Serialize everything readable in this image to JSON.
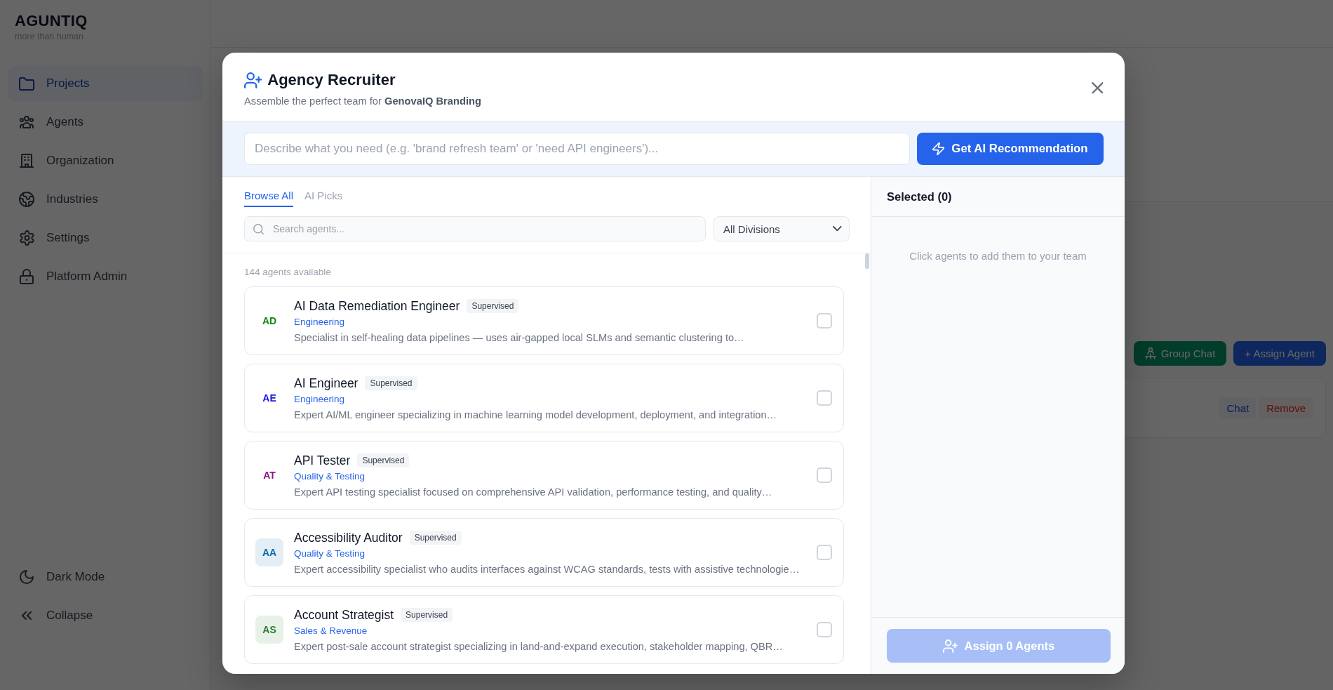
{
  "sidebar": {
    "logo": "AGUNTIQ",
    "tagline": "more than human",
    "nav_items": [
      {
        "label": "Projects",
        "selected": true
      },
      {
        "label": "Agents",
        "selected": false
      },
      {
        "label": "Organization",
        "selected": false
      },
      {
        "label": "Industries",
        "selected": false
      },
      {
        "label": "Settings",
        "selected": false
      },
      {
        "label": "Platform Admin",
        "selected": false
      }
    ],
    "footer_items": [
      {
        "label": "Dark Mode"
      },
      {
        "label": "Collapse"
      }
    ]
  },
  "background_page": {
    "toolbar_buttons": [
      {
        "label": "Group Chat",
        "kind": "success"
      },
      {
        "label": "+ Assign Agent",
        "kind": "primary"
      }
    ],
    "member_row": {
      "actions": [
        {
          "label": "Chat",
          "kind": "neutral"
        },
        {
          "label": "Remove",
          "kind": "danger"
        }
      ]
    }
  },
  "dialog": {
    "title": "Agency Recruiter",
    "subtitle": "Assemble the perfect team for **GenovaIQ Branding**",
    "request": {
      "placeholder": "Describe what you need (e.g. 'brand refresh team' or 'need API engineers')...",
      "button": "Get AI Recommendation"
    },
    "tabs": [
      {
        "label": "Browse All",
        "selected": true
      },
      {
        "label": "AI Picks",
        "selected": false
      }
    ],
    "search": {
      "placeholder": "Search agents..."
    },
    "division_filter": {
      "value": "All Divisions"
    },
    "count": "144 agents available",
    "agents": [
      {
        "initials": "AD",
        "color": "#118811",
        "tinted": false,
        "name": "AI Data Remediation Engineer",
        "badge": "Supervised",
        "division": "Engineering",
        "description": "Specialist in self-healing data pipelines — uses air-gapped local SLMs and semantic clustering to…",
        "checked": false
      },
      {
        "initials": "AE",
        "color": "#1515e0",
        "tinted": false,
        "name": "AI Engineer",
        "badge": "Supervised",
        "division": "Engineering",
        "description": "Expert AI/ML engineer specializing in machine learning model development, deployment, and integration…",
        "checked": false
      },
      {
        "initials": "AT",
        "color": "#8b168b",
        "tinted": false,
        "name": "API Tester",
        "badge": "Supervised",
        "division": "Quality & Testing",
        "description": "Expert API testing specialist focused on comprehensive API validation, performance testing, and quality…",
        "checked": false
      },
      {
        "initials": "AA",
        "color": "#0b6aa6",
        "tinted": true,
        "name": "Accessibility Auditor",
        "badge": "Supervised",
        "division": "Quality & Testing",
        "description": "Expert accessibility specialist who audits interfaces against WCAG standards, tests with assistive technologie…",
        "checked": false
      },
      {
        "initials": "AS",
        "color": "#2e7d32",
        "tinted": true,
        "name": "Account Strategist",
        "badge": "Supervised",
        "division": "Sales & Revenue",
        "description": "Expert post-sale account strategist specializing in land-and-expand execution, stakeholder mapping, QBR…",
        "checked": false
      }
    ],
    "selected_panel": {
      "title": "Selected (0)",
      "empty_text": "Click agents to add them to your team",
      "assign_button": {
        "label": "Assign 0 Agents",
        "disabled": true
      }
    }
  }
}
